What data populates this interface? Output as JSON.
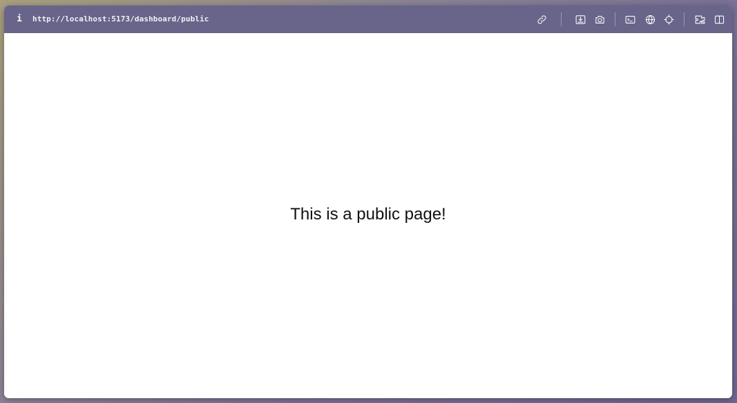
{
  "browser": {
    "url": "http://localhost:5173/dashboard/public",
    "info_icon": "i",
    "toolbar_icons": [
      "link-icon",
      "install-icon",
      "screenshot-icon",
      "terminal-icon",
      "globe-icon",
      "crosshair-icon",
      "extensions-icon",
      "split-view-icon"
    ]
  },
  "page": {
    "message": "This is a public page!"
  }
}
